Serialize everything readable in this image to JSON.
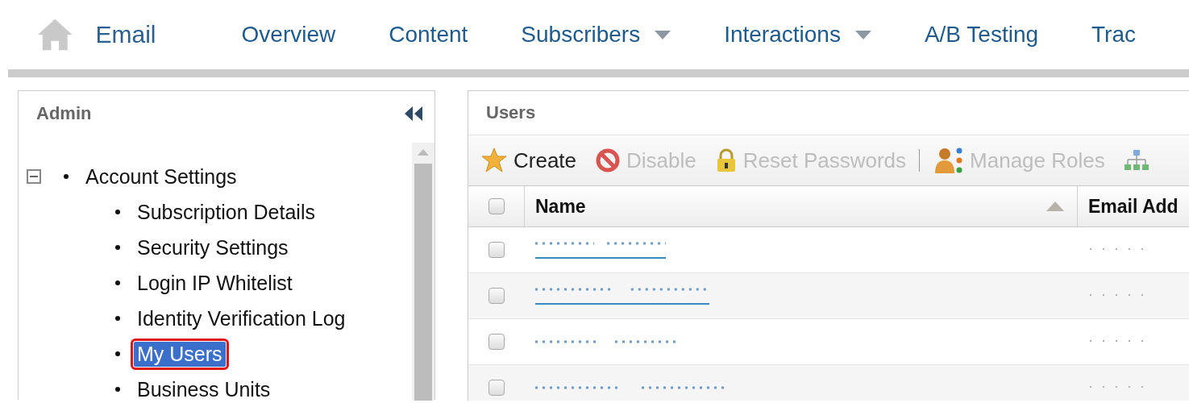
{
  "app": {
    "title": "Email"
  },
  "nav": [
    {
      "label": "Overview",
      "dropdown": false
    },
    {
      "label": "Content",
      "dropdown": false
    },
    {
      "label": "Subscribers",
      "dropdown": true
    },
    {
      "label": "Interactions",
      "dropdown": true
    },
    {
      "label": "A/B Testing",
      "dropdown": false
    },
    {
      "label": "Trac",
      "dropdown": false
    }
  ],
  "sidebar": {
    "title": "Admin",
    "items": [
      {
        "label": "Account Settings",
        "expanded": true,
        "selected": false,
        "children": [
          {
            "label": "Subscription Details",
            "selected": false
          },
          {
            "label": "Security Settings",
            "selected": false
          },
          {
            "label": "Login IP Whitelist",
            "selected": false
          },
          {
            "label": "Identity Verification Log",
            "selected": false
          },
          {
            "label": "My Users",
            "selected": true
          },
          {
            "label": "Business Units",
            "selected": false
          }
        ]
      }
    ]
  },
  "users": {
    "title": "Users",
    "toolbar": [
      {
        "label": "Create",
        "kind": "create",
        "disabled": false
      },
      {
        "label": "Disable",
        "kind": "disable",
        "disabled": true
      },
      {
        "label": "Reset Passwords",
        "kind": "lock",
        "disabled": true
      },
      {
        "label": "Manage Roles",
        "kind": "roles",
        "disabled": true
      },
      {
        "kind": "hierarchy",
        "disabled": true
      }
    ],
    "all_checked": false,
    "columns": [
      {
        "label": "Name",
        "sorted": true
      },
      {
        "label": "Email Add",
        "sorted": false
      }
    ],
    "rows": [
      {
        "checked": false,
        "linked": true
      },
      {
        "checked": false,
        "linked": true
      },
      {
        "checked": false,
        "linked": false
      },
      {
        "checked": false,
        "linked": false
      }
    ]
  }
}
